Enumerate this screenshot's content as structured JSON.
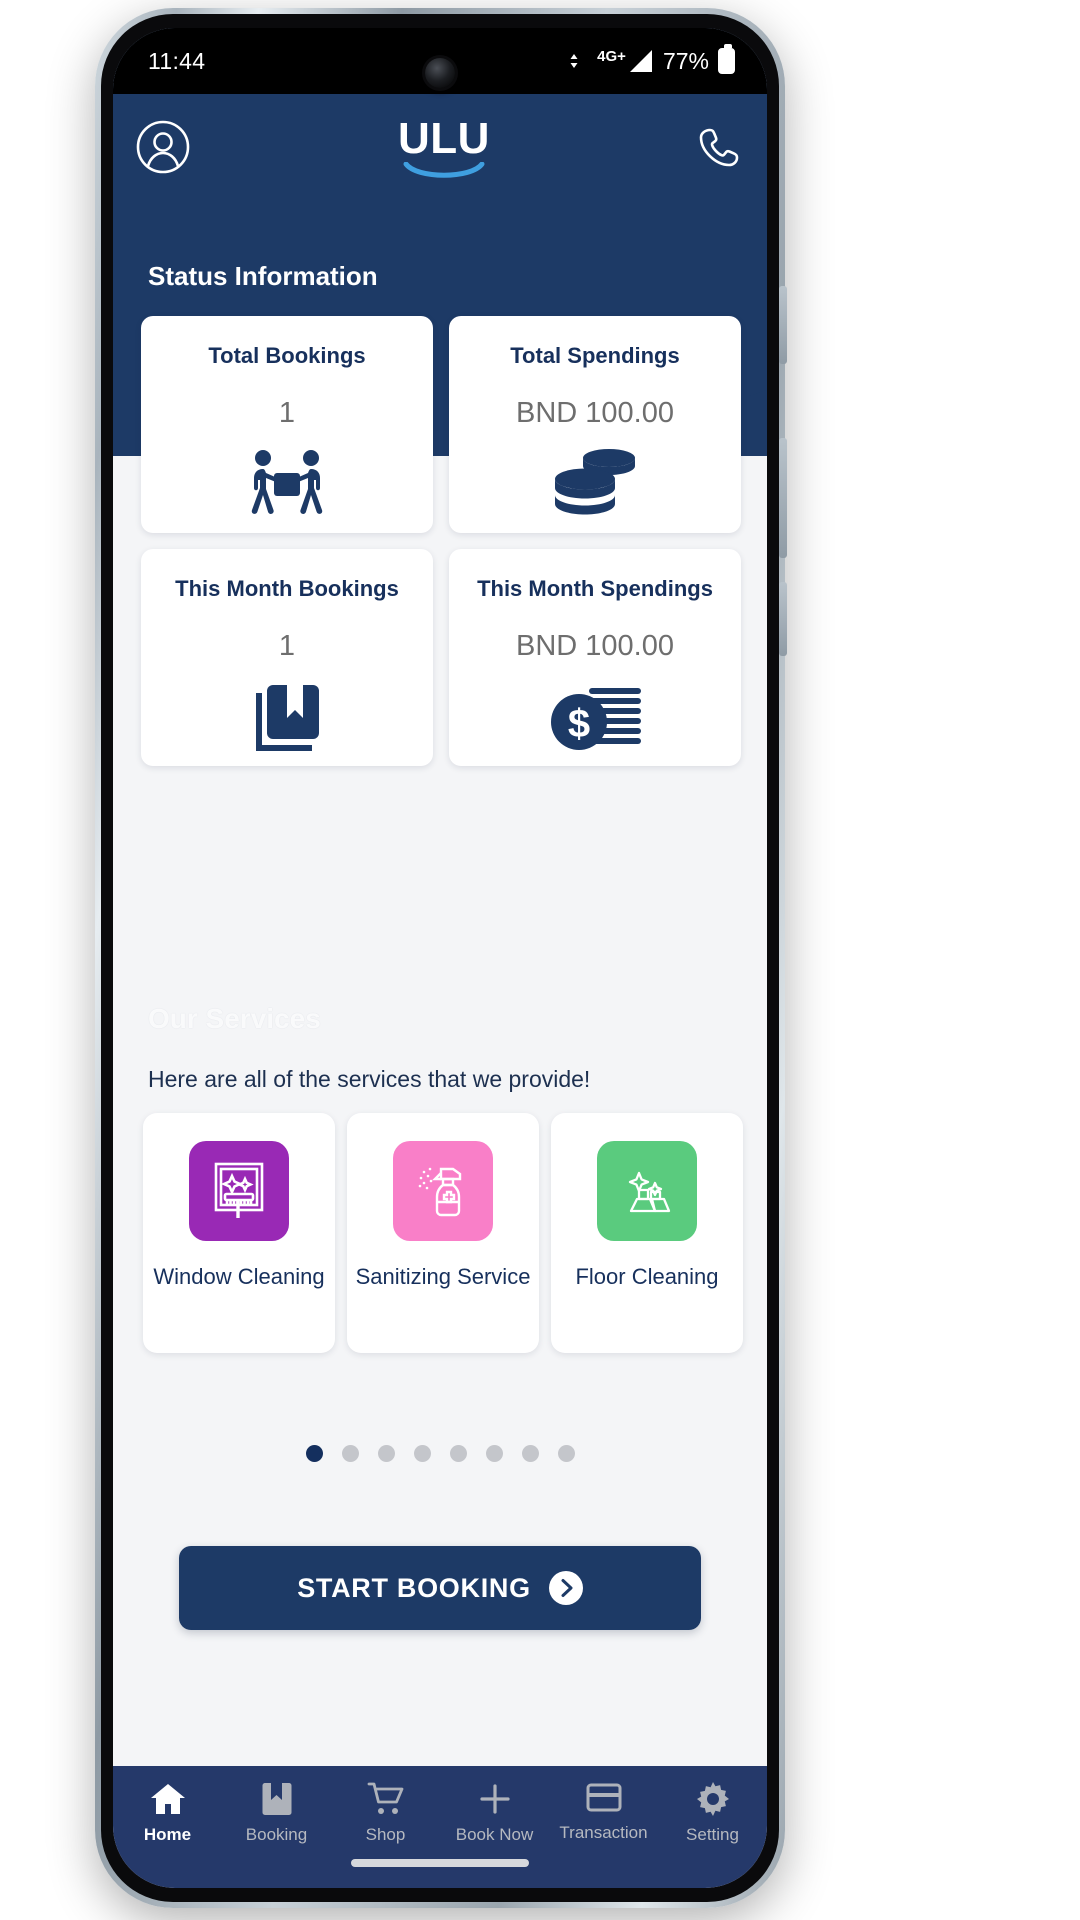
{
  "statusbar": {
    "time": "11:44",
    "network": "4G+",
    "battery_percent": "77%",
    "battery_icon": "battery-icon",
    "signal_icon": "signal-bars-icon",
    "camera_icon": "front-camera"
  },
  "header": {
    "brand": "ULU",
    "profile_icon": "user-circle-icon",
    "call_icon": "phone-icon",
    "section_title": "Status Information",
    "bg_color": "#1d3a66"
  },
  "stats": [
    {
      "label": "Total Bookings",
      "value": "1",
      "icon": "movers-carrying-box-icon"
    },
    {
      "label": "Total Spendings",
      "value": "BND 100.00",
      "icon": "coin-stack-icon"
    },
    {
      "label": "This Month Bookings",
      "value": "1",
      "icon": "bookmark-book-icon"
    },
    {
      "label": "This Month Spendings",
      "value": "BND 100.00",
      "icon": "dollar-coin-stack-icon"
    }
  ],
  "services": {
    "title": "Our Services",
    "subtitle": "Here are all of the services that we provide!",
    "items": [
      {
        "name": "Window Cleaning",
        "icon": "window-squeegee-icon",
        "color": "#9929b5"
      },
      {
        "name": "Sanitizing Service",
        "icon": "spray-bottle-icon",
        "color": "#f97fc8"
      },
      {
        "name": "Floor Cleaning",
        "icon": "sparkling-floor-icon",
        "color": "#5acb7e"
      }
    ],
    "dots_total": 8,
    "dots_active_index": 0,
    "active_dot_color": "#142f5e",
    "inactive_dot_color": "#c4c6cb"
  },
  "cta": {
    "label": "START BOOKING",
    "icon": "chevron-right-circle-icon",
    "color": "#1d3a66"
  },
  "bottom_nav": {
    "items": [
      {
        "label": "Home",
        "icon": "home-icon",
        "active": true
      },
      {
        "label": "Booking",
        "icon": "bookmark-icon",
        "active": false
      },
      {
        "label": "Shop",
        "icon": "cart-icon",
        "active": false
      },
      {
        "label": "Book Now",
        "icon": "plus-icon",
        "active": false
      },
      {
        "label": "Transaction",
        "icon": "credit-card-icon",
        "active": false
      },
      {
        "label": "Setting",
        "icon": "gear-icon",
        "active": false
      }
    ],
    "bg_color": "#25396a"
  }
}
